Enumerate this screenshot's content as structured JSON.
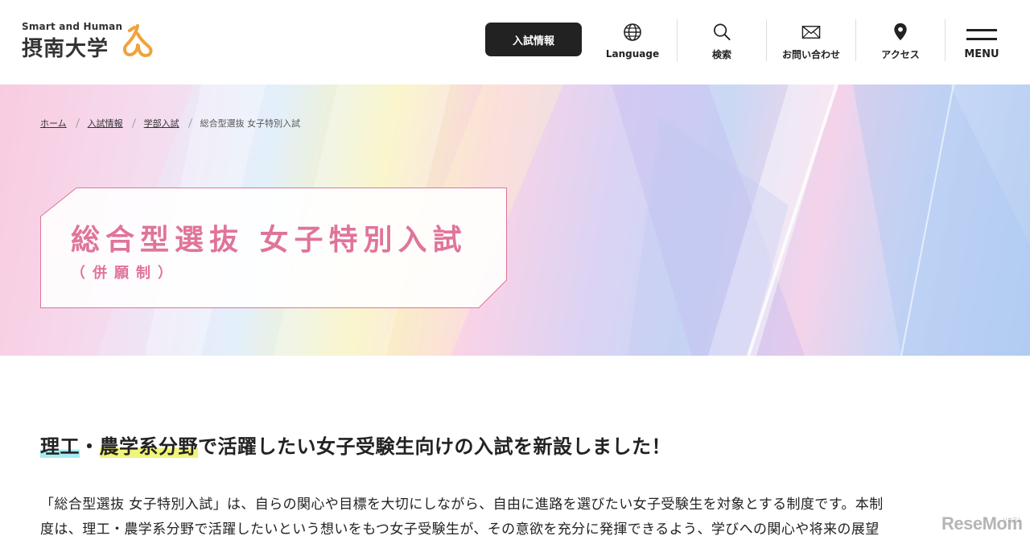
{
  "header": {
    "logo": {
      "tagline": "Smart and Human",
      "name": "摂南大学",
      "brand_color": "#f0a23a"
    },
    "admission_button": "入試情報",
    "nav": [
      {
        "label": "Language",
        "icon": "globe-icon"
      },
      {
        "label": "検索",
        "icon": "search-icon"
      },
      {
        "label": "お問い合わせ",
        "icon": "mail-icon"
      },
      {
        "label": "アクセス",
        "icon": "map-pin-icon"
      },
      {
        "label": "MENU",
        "icon": "hamburger-icon"
      }
    ]
  },
  "hero": {
    "breadcrumb": [
      "ホーム",
      "入試情報",
      "学部入試",
      "総合型選抜 女子特別入試"
    ],
    "title": "総合型選抜 女子特別入試",
    "subtitle": "（併願制）",
    "accent_color": "#e0749a"
  },
  "content": {
    "lead_part1": "理工",
    "lead_part2": "・",
    "lead_part3": "農学系分野",
    "lead_part4": "で活躍したい女子受験生向けの入試を新設しました！",
    "body_line1": "「総合型選抜 女子特別入試」は、自らの関心や目標を大切にしながら、自由に進路を選びたい女子受験生を対象とする制度です。本制",
    "body_line2": "度は、理工・農学系分野で活躍したいという想いをもつ女子受験生が、その意欲を充分に発揮できるよう、学びへの関心や将来の展望"
  },
  "watermark": {
    "text": "ReseMom",
    "sub": "リセマム"
  }
}
